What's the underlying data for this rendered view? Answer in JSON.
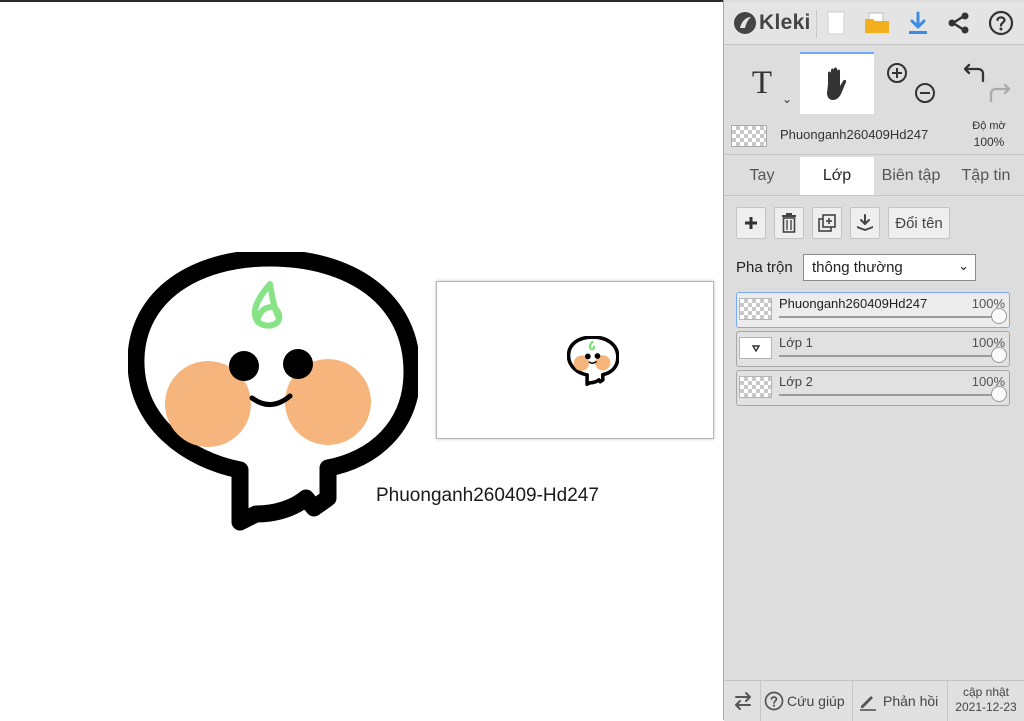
{
  "app": {
    "name": "Kleki"
  },
  "canvas": {
    "caption": "Phuonganh260409-Hd247"
  },
  "toolbar": {
    "icons": [
      "new-image-icon",
      "open-folder-icon",
      "download-icon",
      "share-icon",
      "help-icon"
    ]
  },
  "tools": {
    "text_tool_label": "T",
    "active": "hand"
  },
  "current_layer": {
    "name": "Phuonganh260409Hd247",
    "opacity_label": "Độ mờ",
    "opacity_value": "100%"
  },
  "tabs": [
    {
      "label": "Tay"
    },
    {
      "label": "Lớp"
    },
    {
      "label": "Biên tập"
    },
    {
      "label": "Tập tin"
    }
  ],
  "active_tab": "Lớp",
  "layer_actions": {
    "rename_label": "Đổi tên"
  },
  "blend": {
    "label": "Pha trộn",
    "value": "thông thường"
  },
  "layers": [
    {
      "name": "Phuonganh260409Hd247",
      "opacity": "100%",
      "opacity_fraction": 1.0,
      "selected": true
    },
    {
      "name": "Lớp 1",
      "opacity": "100%",
      "opacity_fraction": 1.0,
      "selected": false
    },
    {
      "name": "Lớp 2",
      "opacity": "100%",
      "opacity_fraction": 1.0,
      "selected": false
    }
  ],
  "footer": {
    "help_label": "Cứu giúp",
    "feedback_label": "Phản hồi",
    "update_label": "cập nhật",
    "update_date": "2021-12-23"
  },
  "colors": {
    "panel_bg": "#dddddd",
    "accent": "#3a8be8",
    "folder": "#f2b01e",
    "peach": "#f6b57c",
    "sprout": "#7be07a"
  }
}
